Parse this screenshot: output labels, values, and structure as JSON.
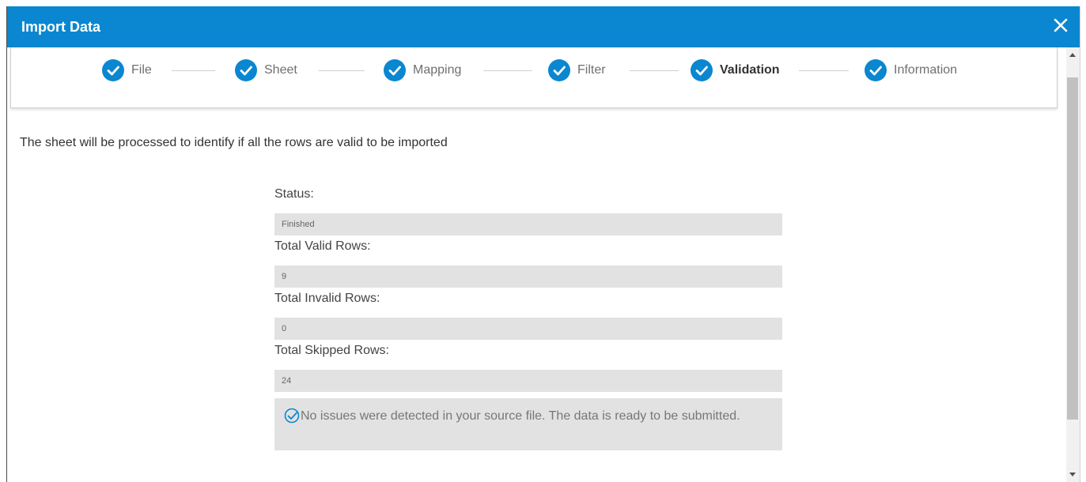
{
  "dialog": {
    "title": "Import Data",
    "close_icon": "close-icon"
  },
  "stepper": {
    "steps": [
      {
        "label": "File",
        "state": "complete"
      },
      {
        "label": "Sheet",
        "state": "complete"
      },
      {
        "label": "Mapping",
        "state": "complete"
      },
      {
        "label": "Filter",
        "state": "complete"
      },
      {
        "label": "Validation",
        "state": "current"
      },
      {
        "label": "Information",
        "state": "complete"
      }
    ],
    "check_icon": "check-circle-icon"
  },
  "main": {
    "intro": "The sheet will be processed to identify if all the rows are valid to be imported",
    "fields": [
      {
        "label": "Status:",
        "value": "Finished"
      },
      {
        "label": "Total Valid Rows:",
        "value": "9"
      },
      {
        "label": "Total Invalid Rows:",
        "value": "0"
      },
      {
        "label": "Total Skipped Rows:",
        "value": "24"
      }
    ],
    "notice": {
      "icon": "check-circle-outline-icon",
      "text": "No issues were detected in your source file. The data is ready to be submitted."
    }
  },
  "colors": {
    "header": "#0a87d0",
    "check": "#0a87d0",
    "field_bg": "#e2e2e2"
  }
}
